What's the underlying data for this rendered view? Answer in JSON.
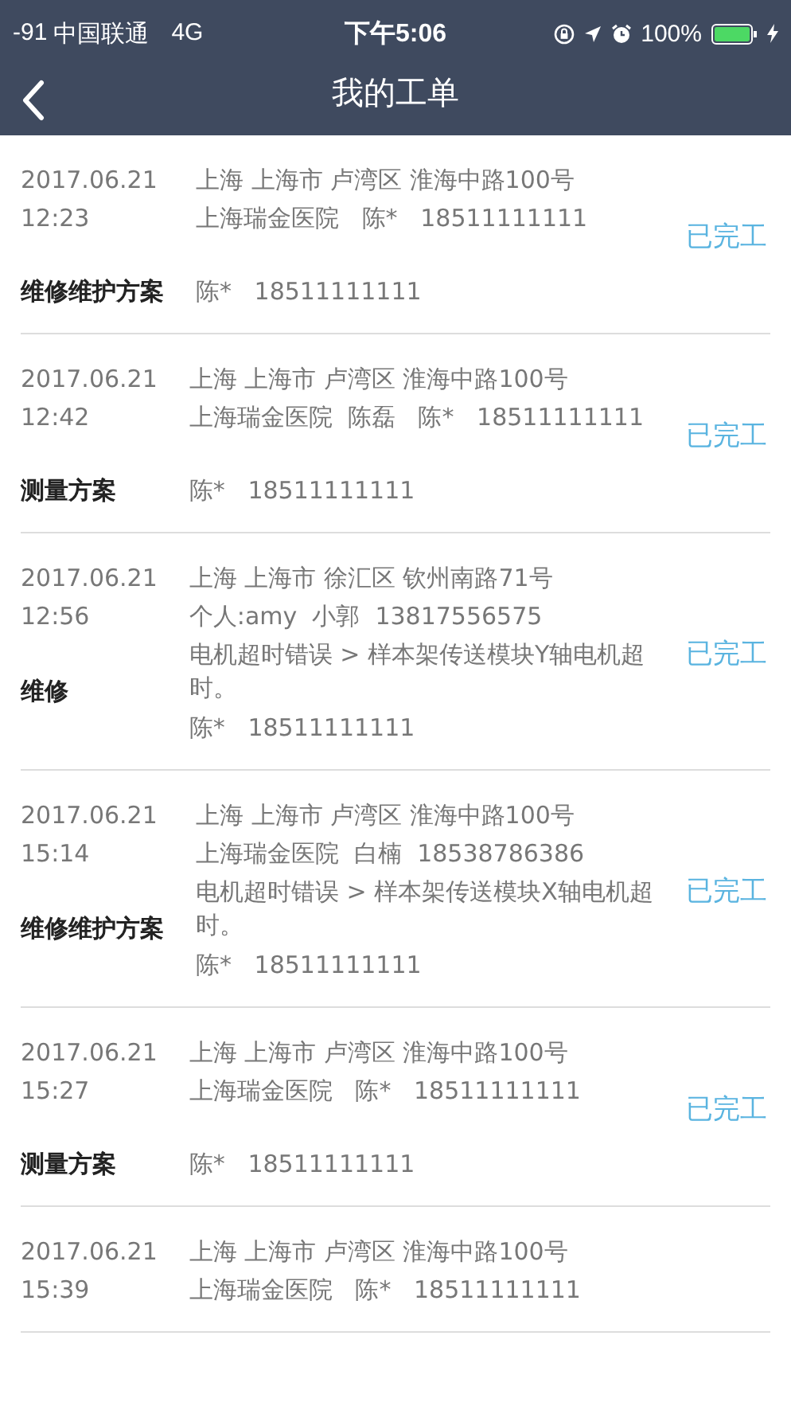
{
  "status_bar": {
    "signal": "-91",
    "carrier": "中国联通",
    "network": "4G",
    "time": "下午5:06",
    "battery": "100%"
  },
  "nav": {
    "title": "我的工单"
  },
  "orders": [
    {
      "date": "2017.06.21",
      "time": "12:23",
      "type": "维修维护方案",
      "address": "上海 上海市 卢湾区 淮海中路100号",
      "contact": "上海瑞金医院   陈*   18511111111",
      "assignee": "陈*   18511111111",
      "status": "已完工"
    },
    {
      "date": "2017.06.21",
      "time": "12:42",
      "type": "测量方案",
      "address": "上海 上海市 卢湾区 淮海中路100号",
      "contact": "上海瑞金医院  陈磊   陈*   18511111111",
      "assignee": "陈*   18511111111",
      "status": "已完工"
    },
    {
      "date": "2017.06.21",
      "time": "12:56",
      "type": "维修",
      "address": "上海 上海市 徐汇区 钦州南路71号",
      "contact": "个人:amy  小郭  13817556575",
      "fault": "电机超时错误 > 样本架传送模块Y轴电机超时。",
      "assignee": "陈*   18511111111",
      "status": "已完工"
    },
    {
      "date": "2017.06.21",
      "time": "15:14",
      "type": "维修维护方案",
      "address": "上海 上海市 卢湾区 淮海中路100号",
      "contact": "上海瑞金医院  白楠  18538786386",
      "fault": "电机超时错误 > 样本架传送模块X轴电机超时。",
      "assignee": "陈*   18511111111",
      "status": "已完工"
    },
    {
      "date": "2017.06.21",
      "time": "15:27",
      "type": "测量方案",
      "address": "上海 上海市 卢湾区 淮海中路100号",
      "contact": "上海瑞金医院   陈*   18511111111",
      "assignee": "陈*   18511111111",
      "status": "已完工"
    },
    {
      "date": "2017.06.21",
      "time": "15:39",
      "address": "上海 上海市 卢湾区 淮海中路100号",
      "contact": "上海瑞金医院   陈*   18511111111"
    }
  ]
}
